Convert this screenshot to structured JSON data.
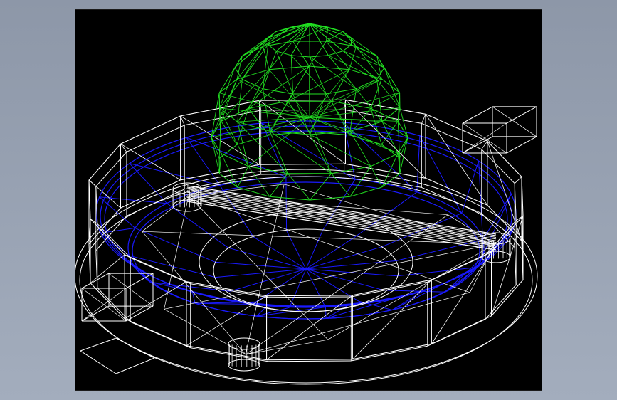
{
  "window": {
    "background_top": "#8d97a8",
    "background_bottom": "#a3adbd"
  },
  "viewport": {
    "background": "#000000",
    "mode": "wireframe"
  },
  "colors": {
    "structure": "#ffffff",
    "inner_bowl": "#1a1aff",
    "dome": "#22e022"
  },
  "objects": [
    {
      "name": "rim-wireframe",
      "color_key": "structure"
    },
    {
      "name": "inner-bowl-wireframe",
      "color_key": "inner_bowl"
    },
    {
      "name": "dome-wireframe",
      "color_key": "dome"
    },
    {
      "name": "crossbeam-wireframe",
      "color_key": "structure"
    },
    {
      "name": "post-cylinders",
      "color_key": "structure"
    },
    {
      "name": "corner-boxes",
      "color_key": "structure"
    }
  ]
}
